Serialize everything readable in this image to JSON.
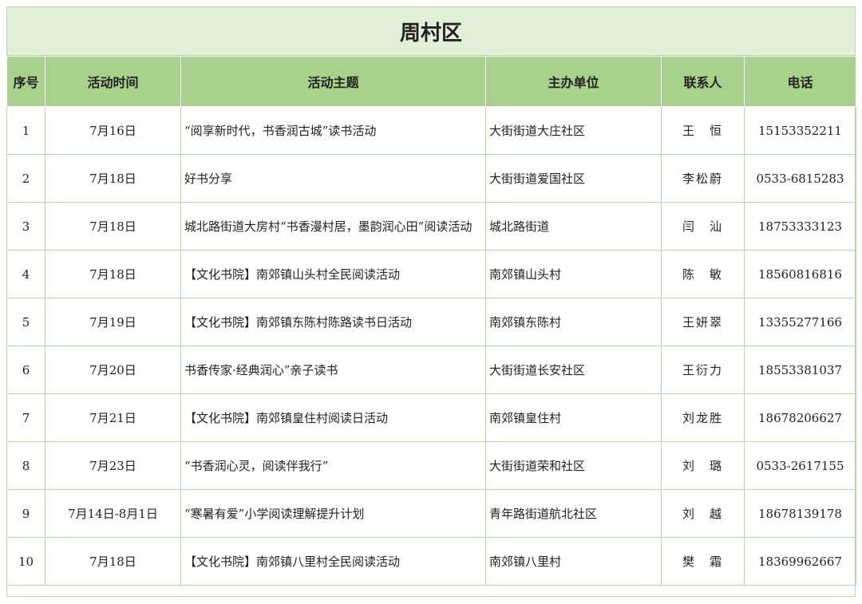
{
  "title": "周村区",
  "headers": [
    "序号",
    "活动时间",
    "活动主题",
    "主办单位",
    "联系人",
    "电话"
  ],
  "rows": [
    {
      "no": "1",
      "date": "7月16日",
      "topic": "“阅享新时代，书香润古城”读书活动",
      "org": "大街街道大庄社区",
      "person": "王　恒",
      "phone": "15153352211"
    },
    {
      "no": "2",
      "date": "7月18日",
      "topic": "好书分享",
      "org": "大街街道爱国社区",
      "person": "李松蔚",
      "phone": "0533-6815283"
    },
    {
      "no": "3",
      "date": "7月18日",
      "topic": "城北路街道大房村“书香漫村居，墨韵润心田”阅读活动",
      "org": "城北路街道",
      "person": "闫　汕",
      "phone": "18753333123"
    },
    {
      "no": "4",
      "date": "7月18日",
      "topic": "【文化书院】南郊镇山头村全民阅读活动",
      "org": "南郊镇山头村",
      "person": "陈　敏",
      "phone": "18560816816"
    },
    {
      "no": "5",
      "date": "7月19日",
      "topic": "【文化书院】南郊镇东陈村陈路读书日活动",
      "org": "南郊镇东陈村",
      "person": "王妍翠",
      "phone": "13355277166"
    },
    {
      "no": "6",
      "date": "7月20日",
      "topic": "书香传家·经典润心”亲子读书",
      "org": "大街街道长安社区",
      "person": "王衍力",
      "phone": "18553381037"
    },
    {
      "no": "7",
      "date": "7月21日",
      "topic": "【文化书院】南郊镇皇住村阅读日活动",
      "org": "南郊镇皇住村",
      "person": "刘龙胜",
      "phone": "18678206627"
    },
    {
      "no": "8",
      "date": "7月23日",
      "topic": "“书香润心灵，阅读伴我行”",
      "org": "大街街道荣和社区",
      "person": "刘　璐",
      "phone": "0533-2617155"
    },
    {
      "no": "9",
      "date": "7月14日-8月1日",
      "topic": "“寒暑有爱”小学阅读理解提升计划",
      "org": "青年路街道航北社区",
      "person": "刘　越",
      "phone": "18678139178"
    },
    {
      "no": "10",
      "date": "7月18日",
      "topic": "【文化书院】南郊镇八里村全民阅读活动",
      "org": "南郊镇八里村",
      "person": "樊　霜",
      "phone": "18369962667"
    }
  ]
}
